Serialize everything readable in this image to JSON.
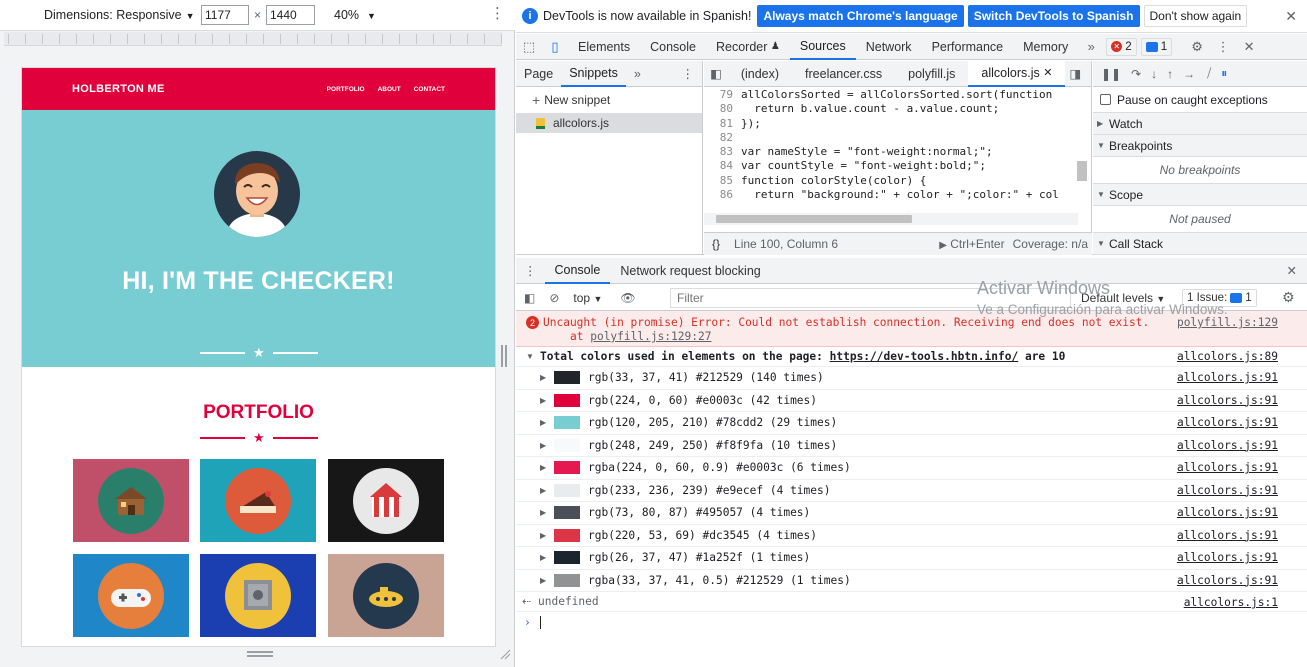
{
  "device_toolbar": {
    "dimensions_label": "Dimensions: Responsive",
    "width_value": "1177",
    "height_value": "1440",
    "times": "×",
    "zoom_label": "40%"
  },
  "site": {
    "brand": "HOLBERTON ME",
    "nav_links": [
      "PORTFOLIO",
      "ABOUT",
      "CONTACT"
    ],
    "hero_title": "HI, I'M THE CHECKER!",
    "portfolio_title": "PORTFOLIO",
    "tiles": [
      {
        "bg": "#c0506a",
        "circle": "#2a7f6b",
        "icon": "cabin-icon"
      },
      {
        "bg": "#1fa3b8",
        "circle": "#dd5a3a",
        "icon": "cake-icon"
      },
      {
        "bg": "#171717",
        "circle": "#e8e8e8",
        "icon": "circus-tent-icon"
      },
      {
        "bg": "#1f86c8",
        "circle": "#e67e3c",
        "icon": "gamepad-icon"
      },
      {
        "bg": "#1b3fb0",
        "circle": "#f0c23b",
        "icon": "safe-icon"
      },
      {
        "bg": "#c9a393",
        "circle": "#24394d",
        "icon": "submarine-icon"
      }
    ],
    "colors": {
      "primary": "#e0003c",
      "hero": "#78cdd2",
      "dark": "#273848"
    }
  },
  "infobar": {
    "message": "DevTools is now available in Spanish!",
    "btn_match": "Always match Chrome's language",
    "btn_switch": "Switch DevTools to Spanish",
    "btn_dont": "Don't show again"
  },
  "main_tabs": [
    "Elements",
    "Console",
    "Recorder",
    "Sources",
    "Network",
    "Performance",
    "Memory"
  ],
  "active_main_tab": "Sources",
  "badges": {
    "errors": "2",
    "issues": "1"
  },
  "navigator": {
    "tabs": [
      "Page",
      "Snippets"
    ],
    "new_snippet": "New snippet",
    "file": "allcolors.js"
  },
  "editor": {
    "tabs": [
      "(index)",
      "freelancer.css",
      "polyfill.js",
      "allcolors.js"
    ],
    "lines": [
      {
        "n": "79",
        "code": "allColorsSorted = allColorsSorted.sort(function"
      },
      {
        "n": "80",
        "code": "  return b.value.count - a.value.count;"
      },
      {
        "n": "81",
        "code": "});"
      },
      {
        "n": "82",
        "code": ""
      },
      {
        "n": "83",
        "code": "var nameStyle = \"font-weight:normal;\";"
      },
      {
        "n": "84",
        "code": "var countStyle = \"font-weight:bold;\";"
      },
      {
        "n": "85",
        "code": "function colorStyle(color) {"
      },
      {
        "n": "86",
        "code": "  return \"background:\" + color + \";color:\" + col"
      }
    ],
    "status_position": "Line 100, Column 6",
    "run_label": "Ctrl+Enter",
    "coverage": "Coverage: n/a"
  },
  "debugger": {
    "pause_caught": "Pause on caught exceptions",
    "sections": [
      {
        "title": "Watch",
        "body": ""
      },
      {
        "title": "Breakpoints",
        "body": "No breakpoints"
      },
      {
        "title": "Scope",
        "body": "Not paused"
      },
      {
        "title": "Call Stack",
        "body": ""
      }
    ]
  },
  "drawer": {
    "tabs": [
      "Console",
      "Network request blocking"
    ]
  },
  "console_toolbar": {
    "context": "top",
    "filter_placeholder": "Filter",
    "levels": "Default levels",
    "issues": "1 Issue:",
    "issues_count": "1"
  },
  "console": {
    "error_count": "2",
    "error_line1": "Uncaught (in promise) Error: Could not establish connection. Receiving end does not exist.",
    "error_line2_prefix": "at ",
    "error_line2_link": "polyfill.js:129:27",
    "error_source": "polyfill.js:129",
    "group_prefix": "Total colors used in elements on the page: ",
    "group_link": "https://dev-tools.hbtn.info/",
    "group_suffix": " are 10",
    "group_source": "allcolors.js:89",
    "colors": [
      {
        "swatch": "#212529",
        "text": "rgb(33, 37, 41) #212529 (140 times)",
        "source": "allcolors.js:91"
      },
      {
        "swatch": "#e0003c",
        "text": "rgb(224, 0, 60) #e0003c (42 times)",
        "source": "allcolors.js:91"
      },
      {
        "swatch": "#78cdd2",
        "text": "rgb(120, 205, 210) #78cdd2 (29 times)",
        "source": "allcolors.js:91"
      },
      {
        "swatch": "#f8f9fa",
        "text": "rgb(248, 249, 250) #f8f9fa (10 times)",
        "source": "allcolors.js:91"
      },
      {
        "swatch": "#e0003ce6",
        "text": "rgba(224, 0, 60, 0.9) #e0003c (6 times)",
        "source": "allcolors.js:91"
      },
      {
        "swatch": "#e9ecef",
        "text": "rgb(233, 236, 239) #e9ecef (4 times)",
        "source": "allcolors.js:91"
      },
      {
        "swatch": "#495057",
        "text": "rgb(73, 80, 87) #495057 (4 times)",
        "source": "allcolors.js:91"
      },
      {
        "swatch": "#dc3545",
        "text": "rgb(220, 53, 69) #dc3545 (4 times)",
        "source": "allcolors.js:91"
      },
      {
        "swatch": "#1a252f",
        "text": "rgb(26, 37, 47) #1a252f (1 times)",
        "source": "allcolors.js:91"
      },
      {
        "swatch": "#21252980",
        "text": "rgba(33, 37, 41, 0.5) #212529 (1 times)",
        "source": "allcolors.js:91"
      }
    ],
    "undefined_text": "undefined",
    "undefined_source": "allcolors.js:1"
  },
  "watermark": {
    "line1": "Activar Windows",
    "line2": "Ve a Configuración para activar Windows."
  }
}
